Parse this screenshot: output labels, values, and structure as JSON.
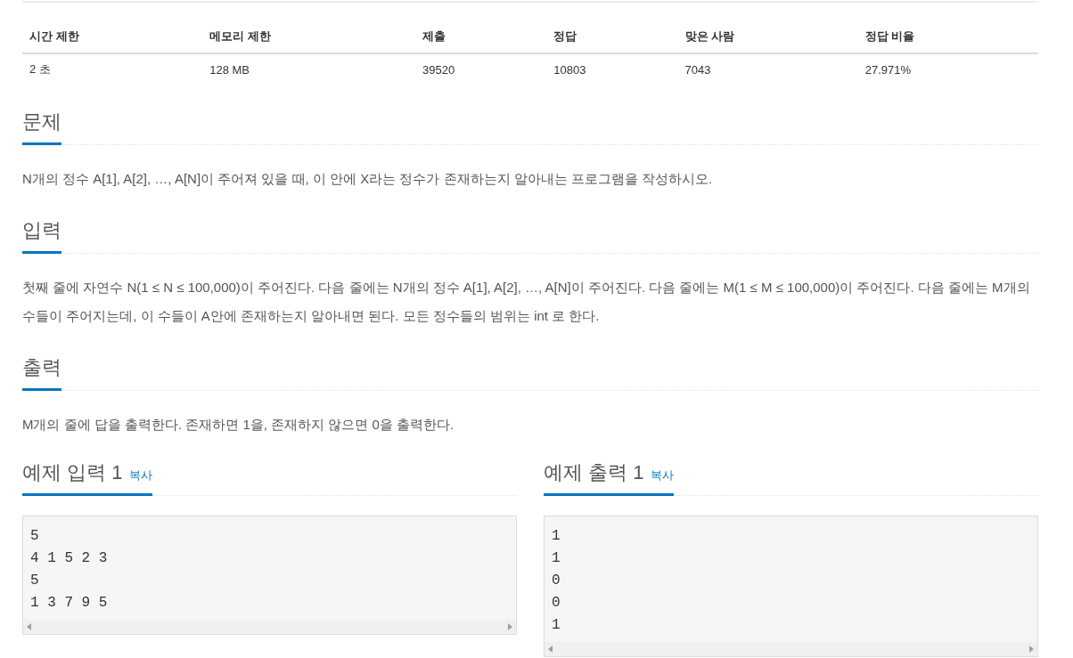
{
  "limits_table": {
    "columns": [
      "시간 제한",
      "메모리 제한",
      "제출",
      "정답",
      "맞은 사람",
      "정답 비율"
    ],
    "rows": [
      [
        "2 초",
        "128 MB",
        "39520",
        "10803",
        "7043",
        "27.971%"
      ]
    ]
  },
  "sections": [
    {
      "title": "문제",
      "paragraphs": [
        "N개의 정수 A[1], A[2], …, A[N]이 주어져 있을 때, 이 안에 X라는 정수가 존재하는지 알아내는 프로그램을 작성하시오."
      ]
    },
    {
      "title": "입력",
      "paragraphs": [
        "첫째 줄에 자연수 N(1 ≤ N ≤ 100,000)이 주어진다. 다음 줄에는 N개의 정수 A[1], A[2], …, A[N]이 주어진다. 다음 줄에는 M(1 ≤ M ≤ 100,000)이 주어진다. 다음 줄에는 M개의 수들이 주어지는데, 이 수들이 A안에 존재하는지 알아내면 된다. 모든 정수들의 범위는 int 로 한다."
      ]
    },
    {
      "title": "출력",
      "paragraphs": [
        "M개의 줄에 답을 출력한다. 존재하면 1을, 존재하지 않으면 0을 출력한다."
      ]
    }
  ],
  "samples": [
    {
      "title": "예제 입력 1",
      "copy_label": "복사",
      "lines": [
        "5",
        "4 1 5 2 3",
        "5",
        "1 3 7 9 5"
      ]
    },
    {
      "title": "예제 출력 1",
      "copy_label": "복사",
      "lines": [
        "1",
        "1",
        "0",
        "0",
        "1"
      ]
    }
  ]
}
